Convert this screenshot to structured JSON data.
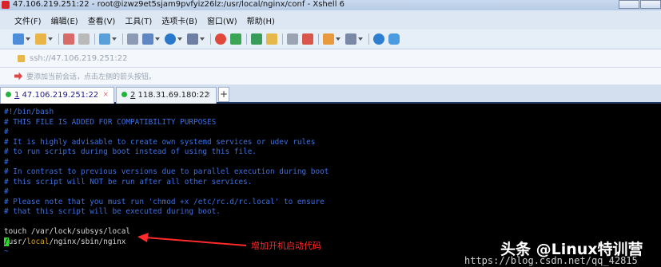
{
  "window": {
    "title": "47.106.219.251:22 - root@izwz9et5sjam9pvfyiz26lz:/usr/local/nginx/conf - Xshell 6"
  },
  "menu": [
    "文件(F)",
    "编辑(E)",
    "查看(V)",
    "工具(T)",
    "选项卡(B)",
    "窗口(W)",
    "帮助(H)"
  ],
  "toolbar": {
    "icons": [
      "new-session-icon",
      "open-folder-icon",
      "connect-icon",
      "disconnect-icon",
      "reconnect-icon",
      "find-icon",
      "layout-icon",
      "globe-icon",
      "font-icon",
      "xshell-icon",
      "xftp-icon",
      "fullscreen-icon",
      "lock-icon",
      "keyboard-icon",
      "highlight-icon",
      "compose-icon",
      "tile-icon",
      "help-icon",
      "chat-icon"
    ]
  },
  "address": {
    "value": "ssh://47.106.219.251:22"
  },
  "hint": {
    "text": "要添加当前会话，点击左侧的箭头按钮。"
  },
  "tabs": [
    {
      "index": "1",
      "label": " 47.106.219.251:22",
      "active": true
    },
    {
      "index": "2",
      "label": " 118.31.69.180:22",
      "active": false
    }
  ],
  "terminal": {
    "lines": [
      "#!/bin/bash",
      "# THIS FILE IS ADDED FOR COMPATIBILITY PURPOSES",
      "#",
      "# It is highly advisable to create own systemd services or udev rules",
      "# to run scripts during boot instead of using this file.",
      "#",
      "# In contrast to previous versions due to parallel execution during boot",
      "# this script will NOT be run after all other services.",
      "#",
      "# Please note that you must run 'chmod +x /etc/rc.d/rc.local' to ensure",
      "# that this script will be executed during boot.",
      "",
      "touch /var/lock/subsys/local"
    ],
    "last_line": {
      "cursor_char": "/",
      "part1": "usr/",
      "part2": "local",
      "part3": "/nginx/sbin/nginx"
    },
    "tilde": "~"
  },
  "annotation": {
    "text": "增加开机启动代码"
  },
  "watermark": {
    "brand": "头条 @Linux特训营",
    "url": "https://blog.csdn.net/qq_42815"
  },
  "colors": {
    "comment": "#3d6fe0",
    "text": "#d8d8d8",
    "keyword": "#d6a21a",
    "cursor": "#33d533",
    "annotation": "#ff2a2a"
  }
}
